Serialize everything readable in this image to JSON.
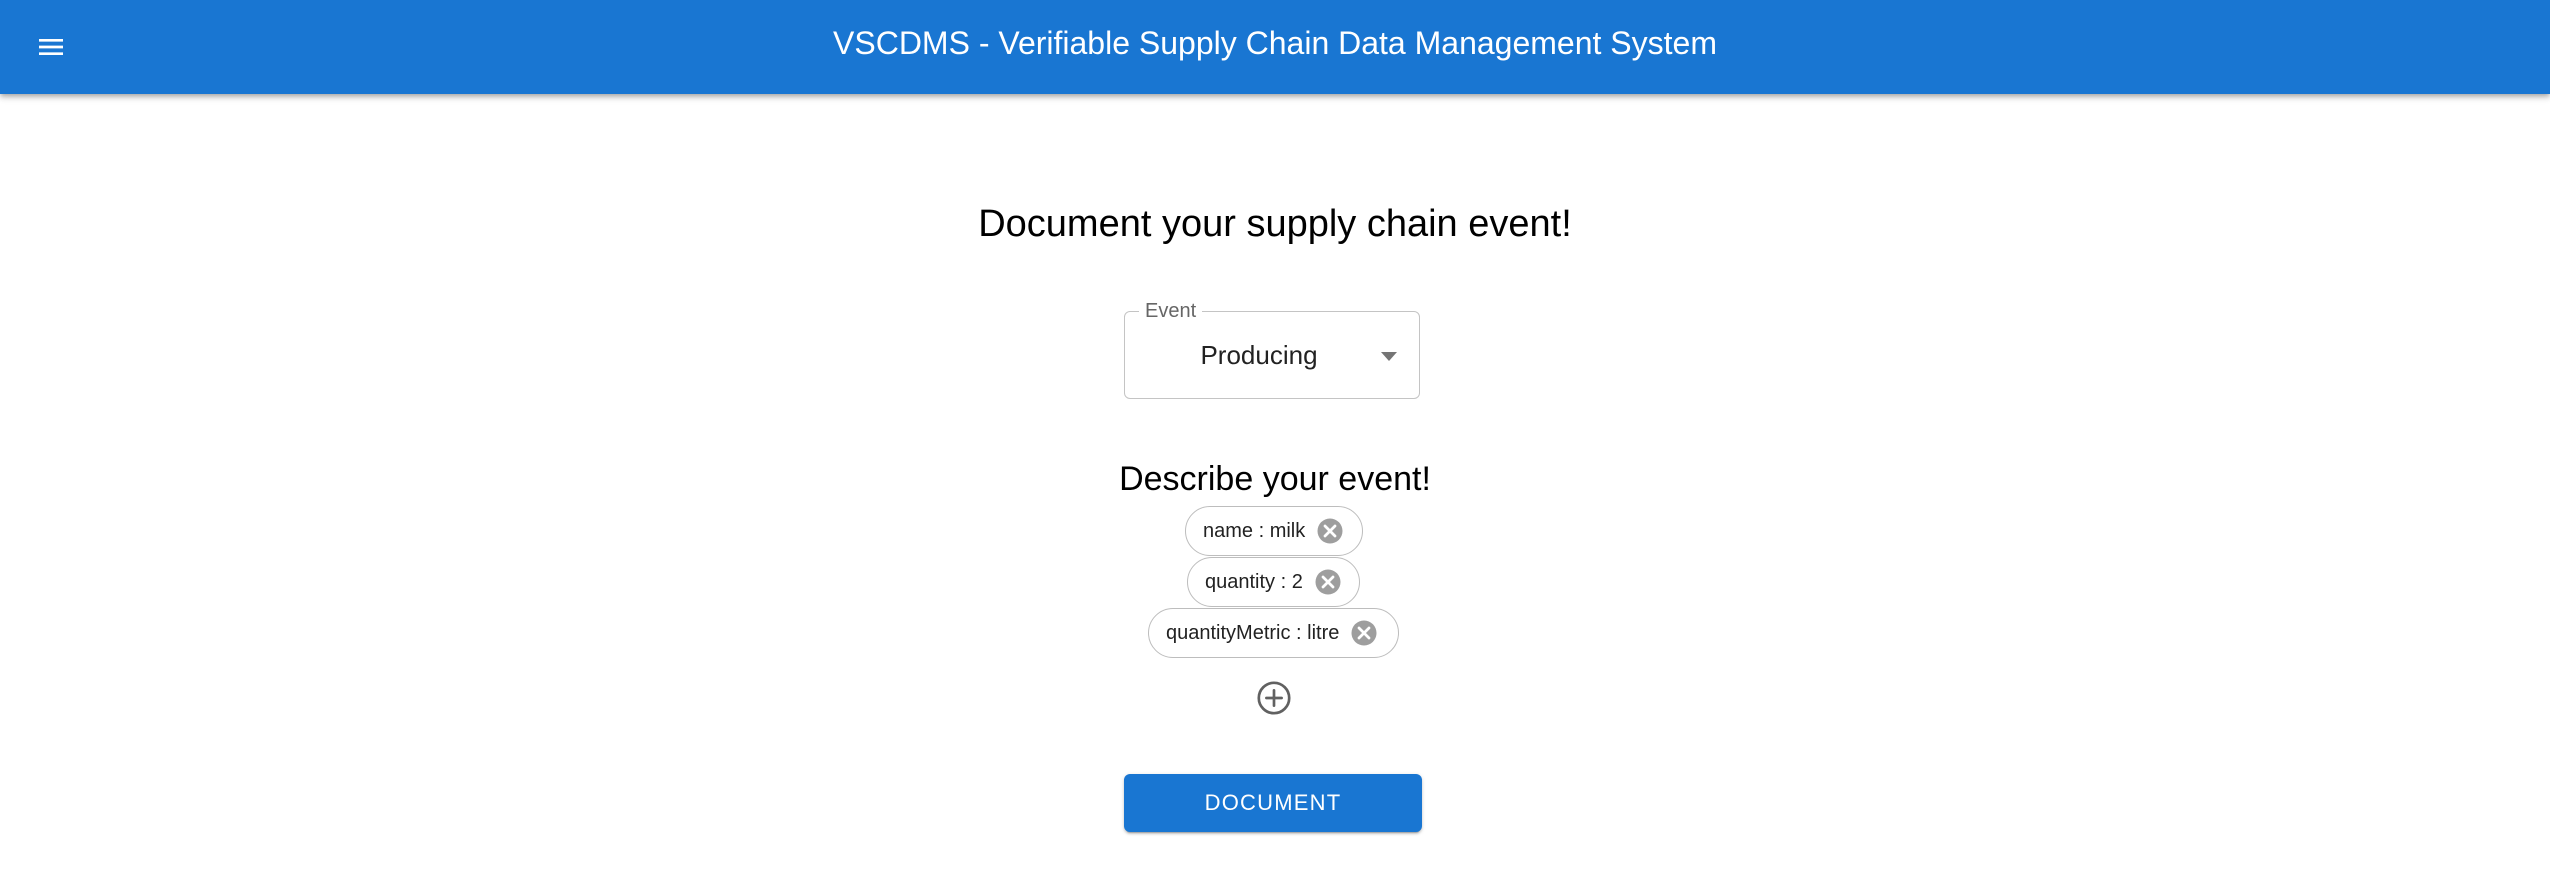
{
  "app_bar": {
    "title": "VSCDMS - Verifiable Supply Chain Data Management System",
    "menu_icon": "menu-icon",
    "color": "#1976d2"
  },
  "main": {
    "heading": "Document your supply chain event!",
    "event_select": {
      "label": "Event",
      "value": "Producing"
    },
    "describe_heading": "Describe your event!",
    "attributes": [
      {
        "label": "name : milk"
      },
      {
        "label": "quantity : 2"
      },
      {
        "label": "quantityMetric : litre"
      }
    ],
    "add_icon": "add-circle-icon",
    "submit_label": "Document"
  }
}
